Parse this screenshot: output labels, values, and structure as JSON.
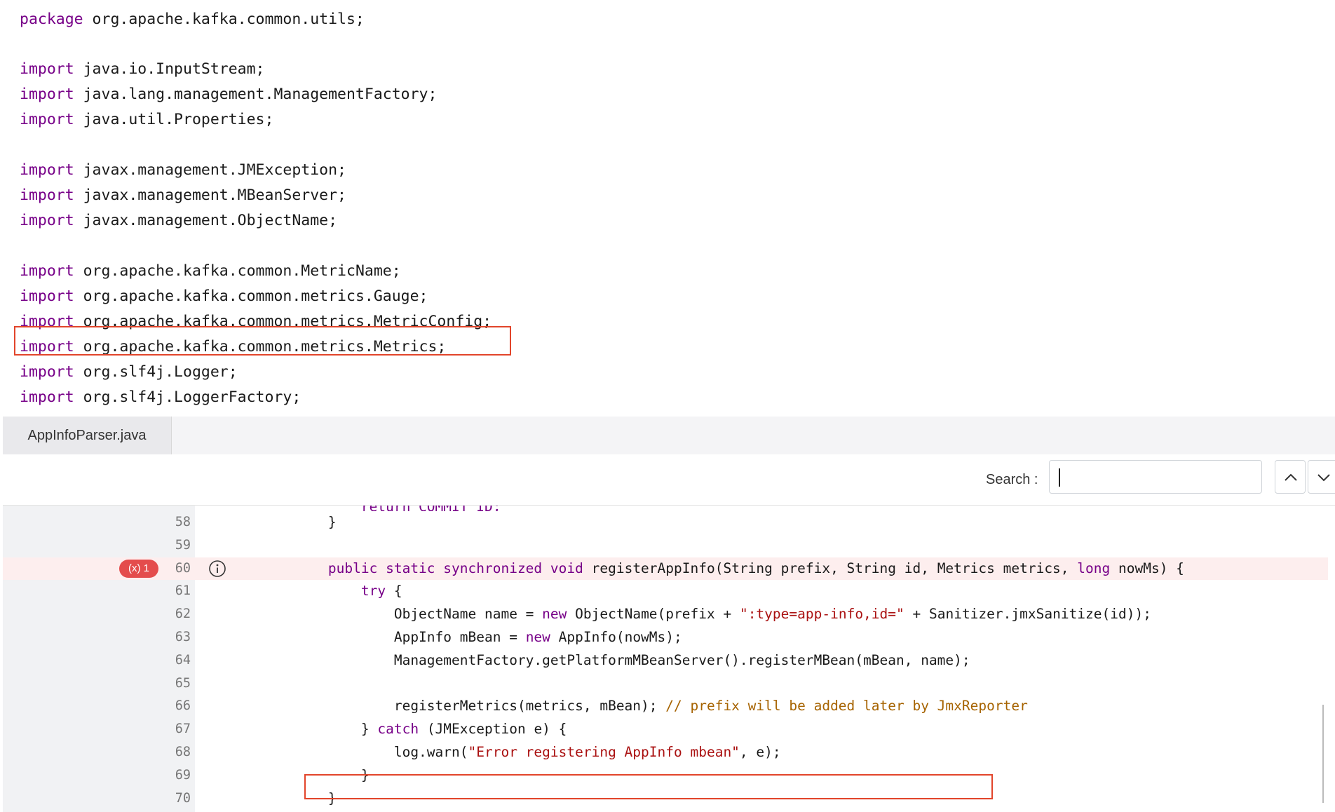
{
  "top_code": {
    "lines": [
      {
        "kw": "package",
        "rest": " org.apache.kafka.common.utils;"
      },
      {
        "kw": "import",
        "rest": " java.io.InputStream;"
      },
      {
        "kw": "import",
        "rest": " java.lang.management.ManagementFactory;"
      },
      {
        "kw": "import",
        "rest": " java.util.Properties;"
      },
      {
        "kw": "import",
        "rest": " javax.management.JMException;"
      },
      {
        "kw": "import",
        "rest": " javax.management.MBeanServer;"
      },
      {
        "kw": "import",
        "rest": " javax.management.ObjectName;"
      },
      {
        "kw": "import",
        "rest": " org.apache.kafka.common.MetricName;"
      },
      {
        "kw": "import",
        "rest": " org.apache.kafka.common.metrics.Gauge;"
      },
      {
        "kw": "import",
        "rest": " org.apache.kafka.common.metrics.MetricConfig;"
      },
      {
        "kw": "import",
        "rest": " org.apache.kafka.common.metrics.Metrics;"
      },
      {
        "kw": "import",
        "rest": " org.slf4j.Logger;"
      },
      {
        "kw": "import",
        "rest": " org.slf4j.LoggerFactory;"
      }
    ]
  },
  "editor": {
    "tab_label": "AppInfoParser.java",
    "search_label": "Search :",
    "search_value": "",
    "error_badge": "(x) 1",
    "partial_line": "            return COMMIT_ID;",
    "lines": [
      {
        "num": "58",
        "parts": [
          {
            "t": "        }",
            "c": ""
          }
        ]
      },
      {
        "num": "59",
        "parts": [
          {
            "t": "",
            "c": ""
          }
        ]
      },
      {
        "num": "60",
        "parts": [
          {
            "t": "        ",
            "c": ""
          },
          {
            "t": "public static synchronized void",
            "c": "kw"
          },
          {
            "t": " registerAppInfo(String prefix, String id, Metrics metrics, ",
            "c": ""
          },
          {
            "t": "long",
            "c": "kw"
          },
          {
            "t": " nowMs) {",
            "c": ""
          }
        ]
      },
      {
        "num": "61",
        "parts": [
          {
            "t": "            ",
            "c": ""
          },
          {
            "t": "try",
            "c": "kw"
          },
          {
            "t": " {",
            "c": ""
          }
        ]
      },
      {
        "num": "62",
        "parts": [
          {
            "t": "                ObjectName name = ",
            "c": ""
          },
          {
            "t": "new",
            "c": "kw"
          },
          {
            "t": " ObjectName(prefix + ",
            "c": ""
          },
          {
            "t": "\":type=app-info,id=\"",
            "c": "str"
          },
          {
            "t": " + Sanitizer.jmxSanitize(id));",
            "c": ""
          }
        ]
      },
      {
        "num": "63",
        "parts": [
          {
            "t": "                AppInfo mBean = ",
            "c": ""
          },
          {
            "t": "new",
            "c": "kw"
          },
          {
            "t": " AppInfo(nowMs);",
            "c": ""
          }
        ]
      },
      {
        "num": "64",
        "parts": [
          {
            "t": "                ManagementFactory.getPlatformMBeanServer().registerMBean(mBean, name);",
            "c": ""
          }
        ]
      },
      {
        "num": "65",
        "parts": [
          {
            "t": "",
            "c": ""
          }
        ]
      },
      {
        "num": "66",
        "parts": [
          {
            "t": "                registerMetrics(metrics, mBean); ",
            "c": ""
          },
          {
            "t": "// prefix will be added later by JmxReporter",
            "c": "com"
          }
        ]
      },
      {
        "num": "67",
        "parts": [
          {
            "t": "            } ",
            "c": ""
          },
          {
            "t": "catch",
            "c": "kw"
          },
          {
            "t": " (JMException e) {",
            "c": ""
          }
        ]
      },
      {
        "num": "68",
        "parts": [
          {
            "t": "                log.warn(",
            "c": ""
          },
          {
            "t": "\"Error registering AppInfo mbean\"",
            "c": "str"
          },
          {
            "t": ", e);",
            "c": ""
          }
        ]
      },
      {
        "num": "69",
        "parts": [
          {
            "t": "            }",
            "c": ""
          }
        ]
      },
      {
        "num": "70",
        "parts": [
          {
            "t": "        }",
            "c": ""
          }
        ]
      }
    ]
  }
}
